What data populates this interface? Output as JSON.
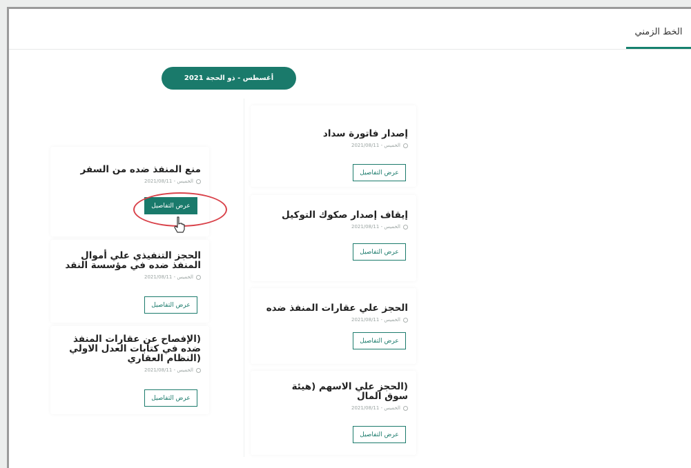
{
  "tabs": [
    {
      "label": "الخط الزمني"
    }
  ],
  "timeline": {
    "period": "أغسطس - ذو الحجة 2021"
  },
  "right_column": [
    {
      "title": "إصدار فاتورة سداد",
      "meta": "الخميس - 2021/08/11",
      "button": "عرض التفاصيل"
    },
    {
      "title": "إيقاف إصدار صكوك التوكيل",
      "meta": "الخميس - 2021/08/11",
      "button": "عرض التفاصيل"
    },
    {
      "title": "الحجز علي عقارات المنفذ ضده",
      "meta": "الخميس - 2021/08/11",
      "button": "عرض التفاصيل"
    },
    {
      "title": "(الحجز علي الاسهم (هيئة سوق المال",
      "meta": "الخميس - 2021/08/11",
      "button": "عرض التفاصيل"
    }
  ],
  "left_column": [
    {
      "title": "منع المنفذ ضده من السفر",
      "meta": "الخميس - 2021/08/11",
      "button": "عرض التفاصيل"
    },
    {
      "title": "الحجز التنفيذي علي أموال المنفذ ضده في مؤسسة النقد",
      "meta": "الخميس - 2021/08/11",
      "button": "عرض التفاصيل"
    },
    {
      "title": "(الإفصاح عن عقارات المنفذ ضده في كتابات العدل الاولي (النظام العقاري",
      "meta": "الخميس - 2021/08/11",
      "button": "عرض التفاصيل"
    }
  ],
  "colors": {
    "accent": "#1a7a6b",
    "highlight": "#d9424a"
  }
}
